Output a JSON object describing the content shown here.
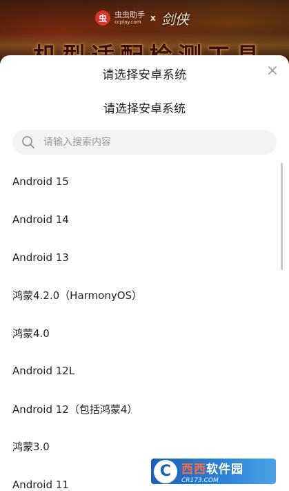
{
  "banner": {
    "logo_mark": "虫",
    "logo_name": "虫虫助手",
    "logo_domain": "ccplay.com",
    "logo_x": "x",
    "partner_logo": "剑侠",
    "title": "机型适配检测工具"
  },
  "sheet": {
    "title": "请选择安卓系统",
    "subtitle": "请选择安卓系统",
    "search": {
      "placeholder": "请输入搜索内容",
      "value": ""
    },
    "items": [
      {
        "label": "Android 15"
      },
      {
        "label": "Android 14"
      },
      {
        "label": "Android 13"
      },
      {
        "label": "鸿蒙4.2.0（HarmonyOS）"
      },
      {
        "label": "鸿蒙4.0"
      },
      {
        "label": "Android 12L"
      },
      {
        "label": "Android 12（包括鸿蒙4）"
      },
      {
        "label": "鸿蒙3.0"
      },
      {
        "label": "Android 11"
      }
    ]
  },
  "watermark": {
    "mark": "C",
    "name_a": "西西",
    "name_b": "软件园",
    "domain": "CR173.COM"
  },
  "icons": {
    "close": "close-icon",
    "search": "search-icon"
  },
  "colors": {
    "sheet_bg": "#ffffff",
    "search_bg": "#f2f3f5",
    "text": "#222222",
    "placeholder": "#9a9a9a"
  }
}
